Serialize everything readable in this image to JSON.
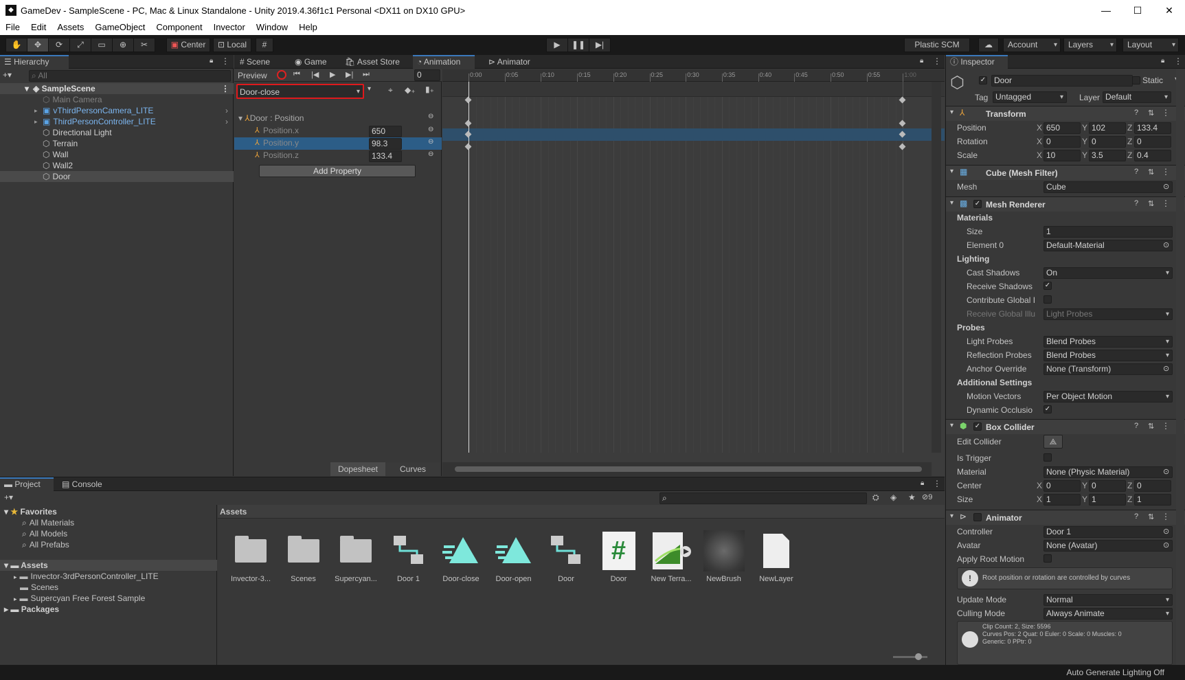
{
  "window": {
    "title": "GameDev - SampleScene - PC, Mac & Linux Standalone - Unity 2019.4.36f1c1 Personal <DX11 on DX10 GPU>",
    "min": "—",
    "max": "☐",
    "close": "✕"
  },
  "menu": [
    "File",
    "Edit",
    "Assets",
    "GameObject",
    "Component",
    "Invector",
    "Window",
    "Help"
  ],
  "toolbar": {
    "center": "Center",
    "local": "Local",
    "plastic": "Plastic SCM",
    "account": "Account",
    "layers": "Layers",
    "layout": "Layout"
  },
  "hierarchy": {
    "tab": "Hierarchy",
    "search": "All",
    "scene": "SampleScene",
    "items": [
      {
        "label": "Main Camera",
        "dim": true
      },
      {
        "label": "vThirdPersonCamera_LITE",
        "prefab": true
      },
      {
        "label": "ThirdPersonController_LITE",
        "prefab": true
      },
      {
        "label": "Directional Light"
      },
      {
        "label": "Terrain"
      },
      {
        "label": "Wall"
      },
      {
        "label": "Wall2"
      },
      {
        "label": "Door",
        "selected": true
      }
    ]
  },
  "center_tabs": [
    "Scene",
    "Game",
    "Asset Store",
    "Animation",
    "Animator"
  ],
  "animation": {
    "preview": "Preview",
    "frame": "0",
    "clip": "Door-close",
    "group": "Door : Position",
    "props": [
      {
        "name": "Position.x",
        "value": "650"
      },
      {
        "name": "Position.y",
        "value": "98.3"
      },
      {
        "name": "Position.z",
        "value": "133.4"
      }
    ],
    "add_property": "Add Property",
    "dopesheet": "Dopesheet",
    "curves": "Curves",
    "ticks": [
      "0:00",
      "0:05",
      "0:10",
      "0:15",
      "0:20",
      "0:25",
      "0:30",
      "0:35",
      "0:40",
      "0:45",
      "0:50",
      "0:55",
      "1:00"
    ]
  },
  "inspector": {
    "tab": "Inspector",
    "name": "Door",
    "static": "Static",
    "tag_label": "Tag",
    "tag": "Untagged",
    "layer_label": "Layer",
    "layer": "Default",
    "transform": {
      "title": "Transform",
      "position": [
        "650",
        "102",
        "133.4"
      ],
      "rotation": [
        "0",
        "0",
        "0"
      ],
      "scale": [
        "10",
        "3.5",
        "0.4"
      ],
      "labels": [
        "Position",
        "Rotation",
        "Scale"
      ]
    },
    "mesh_filter": {
      "title": "Cube (Mesh Filter)",
      "mesh_label": "Mesh",
      "mesh": "Cube"
    },
    "mesh_renderer": {
      "title": "Mesh Renderer",
      "materials": "Materials",
      "size_label": "Size",
      "size": "1",
      "element_label": "Element 0",
      "element": "Default-Material",
      "lighting": "Lighting",
      "cast_label": "Cast Shadows",
      "cast": "On",
      "receive_label": "Receive Shadows",
      "contribute_label": "Contribute Global I",
      "receive_gi_label": "Receive Global Illu",
      "receive_gi": "Light Probes",
      "probes": "Probes",
      "light_probes_label": "Light Probes",
      "light_probes": "Blend Probes",
      "refl_label": "Reflection Probes",
      "refl": "Blend Probes",
      "anchor_label": "Anchor Override",
      "anchor": "None (Transform)",
      "additional": "Additional Settings",
      "motion_label": "Motion Vectors",
      "motion": "Per Object Motion",
      "dynocc_label": "Dynamic Occlusio"
    },
    "box_collider": {
      "title": "Box Collider",
      "edit_label": "Edit Collider",
      "trigger_label": "Is Trigger",
      "material_label": "Material",
      "material": "None (Physic Material)",
      "center_label": "Center",
      "center": [
        "0",
        "0",
        "0"
      ],
      "size_label": "Size",
      "size": [
        "1",
        "1",
        "1"
      ]
    },
    "animator": {
      "title": "Animator",
      "controller_label": "Controller",
      "controller": "Door 1",
      "avatar_label": "Avatar",
      "avatar": "None (Avatar)",
      "root_label": "Apply Root Motion",
      "note": "Root position or rotation are controlled by curves",
      "update_label": "Update Mode",
      "update": "Normal",
      "culling_label": "Culling Mode",
      "culling": "Always Animate",
      "info1": "Clip Count: 2, Size: 5596",
      "info2": "Curves Pos: 2 Quat: 0 Euler: 0 Scale: 0 Muscles: 0",
      "info3": "Generic: 0 PPtr: 0"
    }
  },
  "project": {
    "tabs": [
      "Project",
      "Console"
    ],
    "favorites": "Favorites",
    "fav_items": [
      "All Materials",
      "All Models",
      "All Prefabs"
    ],
    "assets": "Assets",
    "asset_items": [
      "Invector-3rdPersonController_LITE",
      "Scenes",
      "Supercyan Free Forest Sample"
    ],
    "packages": "Packages",
    "hidden_count": "9",
    "header": "Assets",
    "grid": [
      {
        "label": "Invector-3...",
        "kind": "folder"
      },
      {
        "label": "Scenes",
        "kind": "folder"
      },
      {
        "label": "Supercyan...",
        "kind": "folder"
      },
      {
        "label": "Door 1",
        "kind": "controller"
      },
      {
        "label": "Door-close",
        "kind": "anim"
      },
      {
        "label": "Door-open",
        "kind": "anim"
      },
      {
        "label": "Door",
        "kind": "controller"
      },
      {
        "label": "Door",
        "kind": "script"
      },
      {
        "label": "New Terra...",
        "kind": "terrain"
      },
      {
        "label": "NewBrush",
        "kind": "brush"
      },
      {
        "label": "NewLayer",
        "kind": "file"
      }
    ]
  },
  "status": "Auto Generate Lighting Off",
  "colors": {
    "accent": "#3a79bb",
    "selection": "#2c5d87",
    "record_red": "#d22",
    "clip_border": "#e0191c"
  }
}
